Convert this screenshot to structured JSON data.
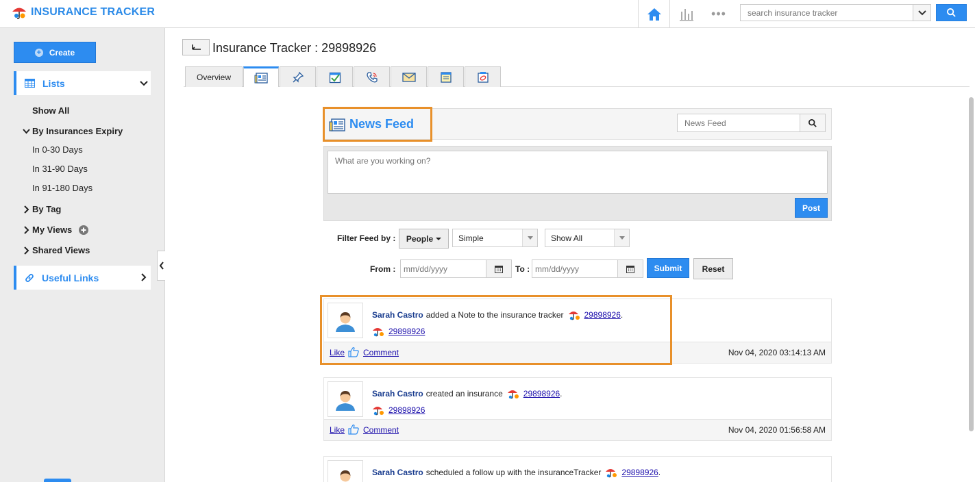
{
  "app": {
    "logo_text": "INSURANCE TRACKER",
    "search_placeholder": "search insurance tracker",
    "more_glyph": "•••"
  },
  "sidebar": {
    "create_label": "Create",
    "lists_label": "Lists",
    "show_all": "Show All",
    "by_expiry": "By Insurances Expiry",
    "expiry_items": [
      "In 0-30 Days",
      "In 31-90 Days",
      "In 91-180 Days"
    ],
    "by_tag": "By Tag",
    "my_views": "My Views",
    "shared_views": "Shared Views",
    "useful_links": "Useful Links"
  },
  "page": {
    "title": "Insurance Tracker : 29898926",
    "tabs": [
      {
        "label": "Overview",
        "icon": "overview"
      },
      {
        "label": "",
        "icon": "news-feed-icon",
        "active": true
      },
      {
        "label": "",
        "icon": "pin-icon"
      },
      {
        "label": "",
        "icon": "task-check-icon"
      },
      {
        "label": "",
        "icon": "phone-call-icon"
      },
      {
        "label": "",
        "icon": "mail-icon"
      },
      {
        "label": "",
        "icon": "note-icon"
      },
      {
        "label": "",
        "icon": "attachment-icon"
      }
    ]
  },
  "news_feed": {
    "title": "News Feed",
    "search_placeholder": "News Feed",
    "post_placeholder": "What are you working on?",
    "post_label": "Post",
    "filter_label": "Filter Feed by :",
    "people_label": "People",
    "type_selected": "Simple",
    "scope_selected": "Show All",
    "from_label": "From :",
    "to_label": "To :",
    "date_placeholder": "mm/dd/yyyy",
    "submit_label": "Submit",
    "reset_label": "Reset"
  },
  "feed": [
    {
      "user": "Sarah Castro",
      "action": "added a Note to the insurance tracker",
      "record": "29898926",
      "sub_record": "29898926",
      "like": "Like",
      "comment": "Comment",
      "timestamp": "Nov 04, 2020 03:14:13 AM"
    },
    {
      "user": "Sarah Castro",
      "action": "created an insurance",
      "record": "29898926",
      "sub_record": "29898926",
      "like": "Like",
      "comment": "Comment",
      "timestamp": "Nov 04, 2020 01:56:58 AM"
    },
    {
      "user": "Sarah Castro",
      "action": "scheduled a follow up with the insuranceTracker",
      "record": "29898926"
    }
  ],
  "colors": {
    "accent": "#2d8cf0",
    "highlight": "#e8902a",
    "user_link": "#1a3d8f"
  }
}
